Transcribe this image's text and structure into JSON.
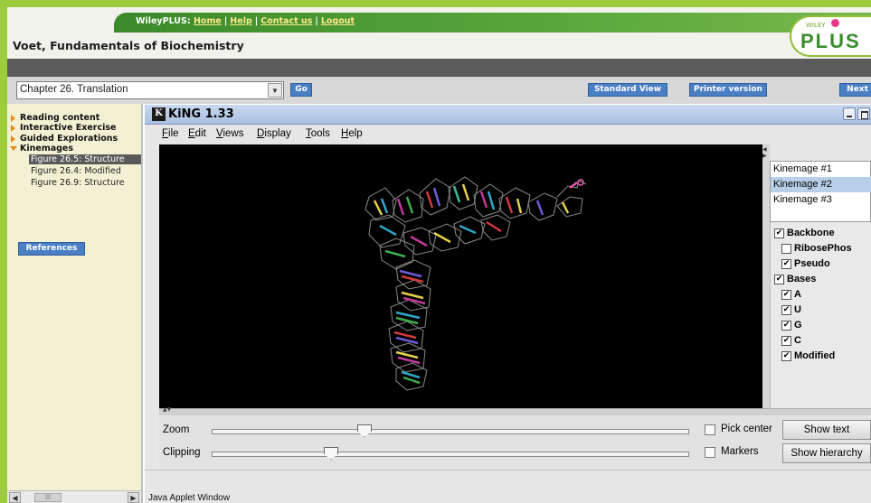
{
  "header": {
    "links": [
      "Home",
      "Help",
      "Contact us",
      "Logout"
    ],
    "brand_prefix": "WileyPLUS:",
    "book_title": "Voet, Fundamentals of Biochemistry",
    "logo_top": "WILEY",
    "logo_main": "PLUS"
  },
  "chapter_bar": {
    "selected_chapter": "Chapter 26. Translation",
    "go_label": "Go",
    "standard_view_label": "Standard View",
    "printer_version_label": "Printer version",
    "next_label": "Next"
  },
  "sidebar": {
    "items": [
      {
        "label": "Reading content"
      },
      {
        "label": "Interactive Exercise"
      },
      {
        "label": "Guided Explorations"
      },
      {
        "label": "Kinemages"
      }
    ],
    "sub_items": [
      {
        "label": "Figure 26.5: Structure",
        "selected": true
      },
      {
        "label": "Figure 26.4: Modified"
      },
      {
        "label": "Figure 26.9: Structure"
      }
    ],
    "references_label": "References"
  },
  "applet": {
    "title": "KiNG 1.33",
    "logo_glyph": "K",
    "menu": [
      "File",
      "Edit",
      "Views",
      "Display",
      "Tools",
      "Help"
    ],
    "kinemages": [
      "Kinemage #1",
      "Kinemage #2",
      "Kinemage #3"
    ],
    "selected_kinemage": 1,
    "groups": [
      {
        "label": "Backbone",
        "checked": true,
        "indent": 0
      },
      {
        "label": "RibosePhos",
        "checked": false,
        "indent": 1
      },
      {
        "label": "Pseudo",
        "checked": true,
        "indent": 1
      },
      {
        "label": "Bases",
        "checked": true,
        "indent": 0
      },
      {
        "label": "A",
        "checked": true,
        "indent": 1
      },
      {
        "label": "U",
        "checked": true,
        "indent": 1
      },
      {
        "label": "G",
        "checked": true,
        "indent": 1
      },
      {
        "label": "C",
        "checked": true,
        "indent": 1
      },
      {
        "label": "Modified",
        "checked": true,
        "indent": 1
      }
    ],
    "zoom_label": "Zoom",
    "zoom_level": 0.32,
    "clipping_label": "Clipping",
    "clipping_level": 0.25,
    "pick_center_label": "Pick center",
    "markers_label": "Markers",
    "show_text_label": "Show text",
    "show_hierarchy_label": "Show hierarchy",
    "status": "Java Applet Window"
  },
  "colors": {
    "brand_green": "#5aa83c",
    "link_yellow": "#ffe98a",
    "button_blue": "#4a7fc4",
    "sidebar_bg": "#f3f1d4",
    "canvas_bg": "#000000",
    "selection_blue": "#b8cfe9"
  }
}
